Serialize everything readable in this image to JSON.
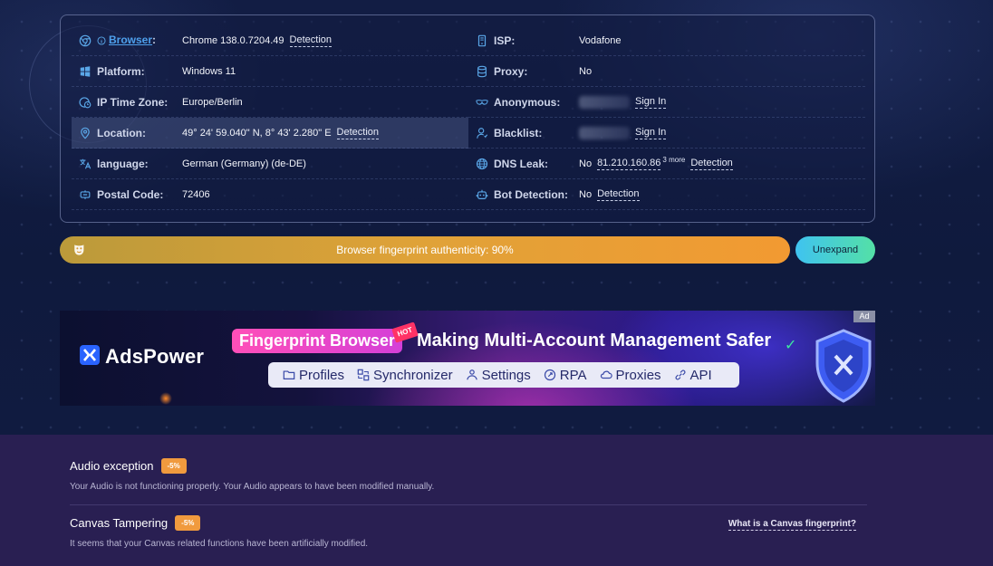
{
  "info": {
    "left": [
      {
        "label": "Browser",
        "value": "Chrome 138.0.7204.49",
        "action": "Detection"
      },
      {
        "label": "Platform:",
        "value": "Windows 11"
      },
      {
        "label": "IP Time Zone:",
        "value": "Europe/Berlin"
      },
      {
        "label": "Location:",
        "value": "49° 24' 59.040\" N, 8° 43' 2.280\" E",
        "action": "Detection"
      },
      {
        "label": "language:",
        "value": "German (Germany) (de-DE)"
      },
      {
        "label": "Postal Code:",
        "value": "72406"
      }
    ],
    "right": [
      {
        "label": "ISP:",
        "value": "Vodafone"
      },
      {
        "label": "Proxy:",
        "value": "No"
      },
      {
        "label": "Anonymous:",
        "action": "Sign In"
      },
      {
        "label": "Blacklist:",
        "action": "Sign In"
      },
      {
        "label": "DNS Leak:",
        "value": "No",
        "ip": "81.210.160.86",
        "more": "3 more",
        "action": "Detection"
      },
      {
        "label": "Bot Detection:",
        "value": "No",
        "action": "Detection"
      }
    ],
    "browser_colon": ":"
  },
  "authenticity": {
    "text": "Browser fingerprint authenticity: 90%",
    "percent": 90,
    "button": "Unexpand"
  },
  "ad": {
    "badge": "Ad",
    "brand": "AdsPower",
    "pill": "Fingerprint Browser",
    "hot": "HOT",
    "headline": "Making Multi-Account Management Safer",
    "features": [
      "Profiles",
      "Synchronizer",
      "Settings",
      "RPA",
      "Proxies",
      "API"
    ]
  },
  "exceptions": [
    {
      "title": "Audio exception",
      "badge": "-5%",
      "desc": "Your Audio is not functioning properly. Your Audio appears to have been modified manually."
    },
    {
      "title": "Canvas Tampering",
      "badge": "-5%",
      "desc": "It seems that your Canvas related functions have been artificially modified.",
      "link": "What is a Canvas fingerprint?"
    }
  ],
  "colors": {
    "accent": "#4ea0ec",
    "progress": "#f29a32",
    "badge": "#f09a3e",
    "bottom_bg": "#291f52"
  }
}
